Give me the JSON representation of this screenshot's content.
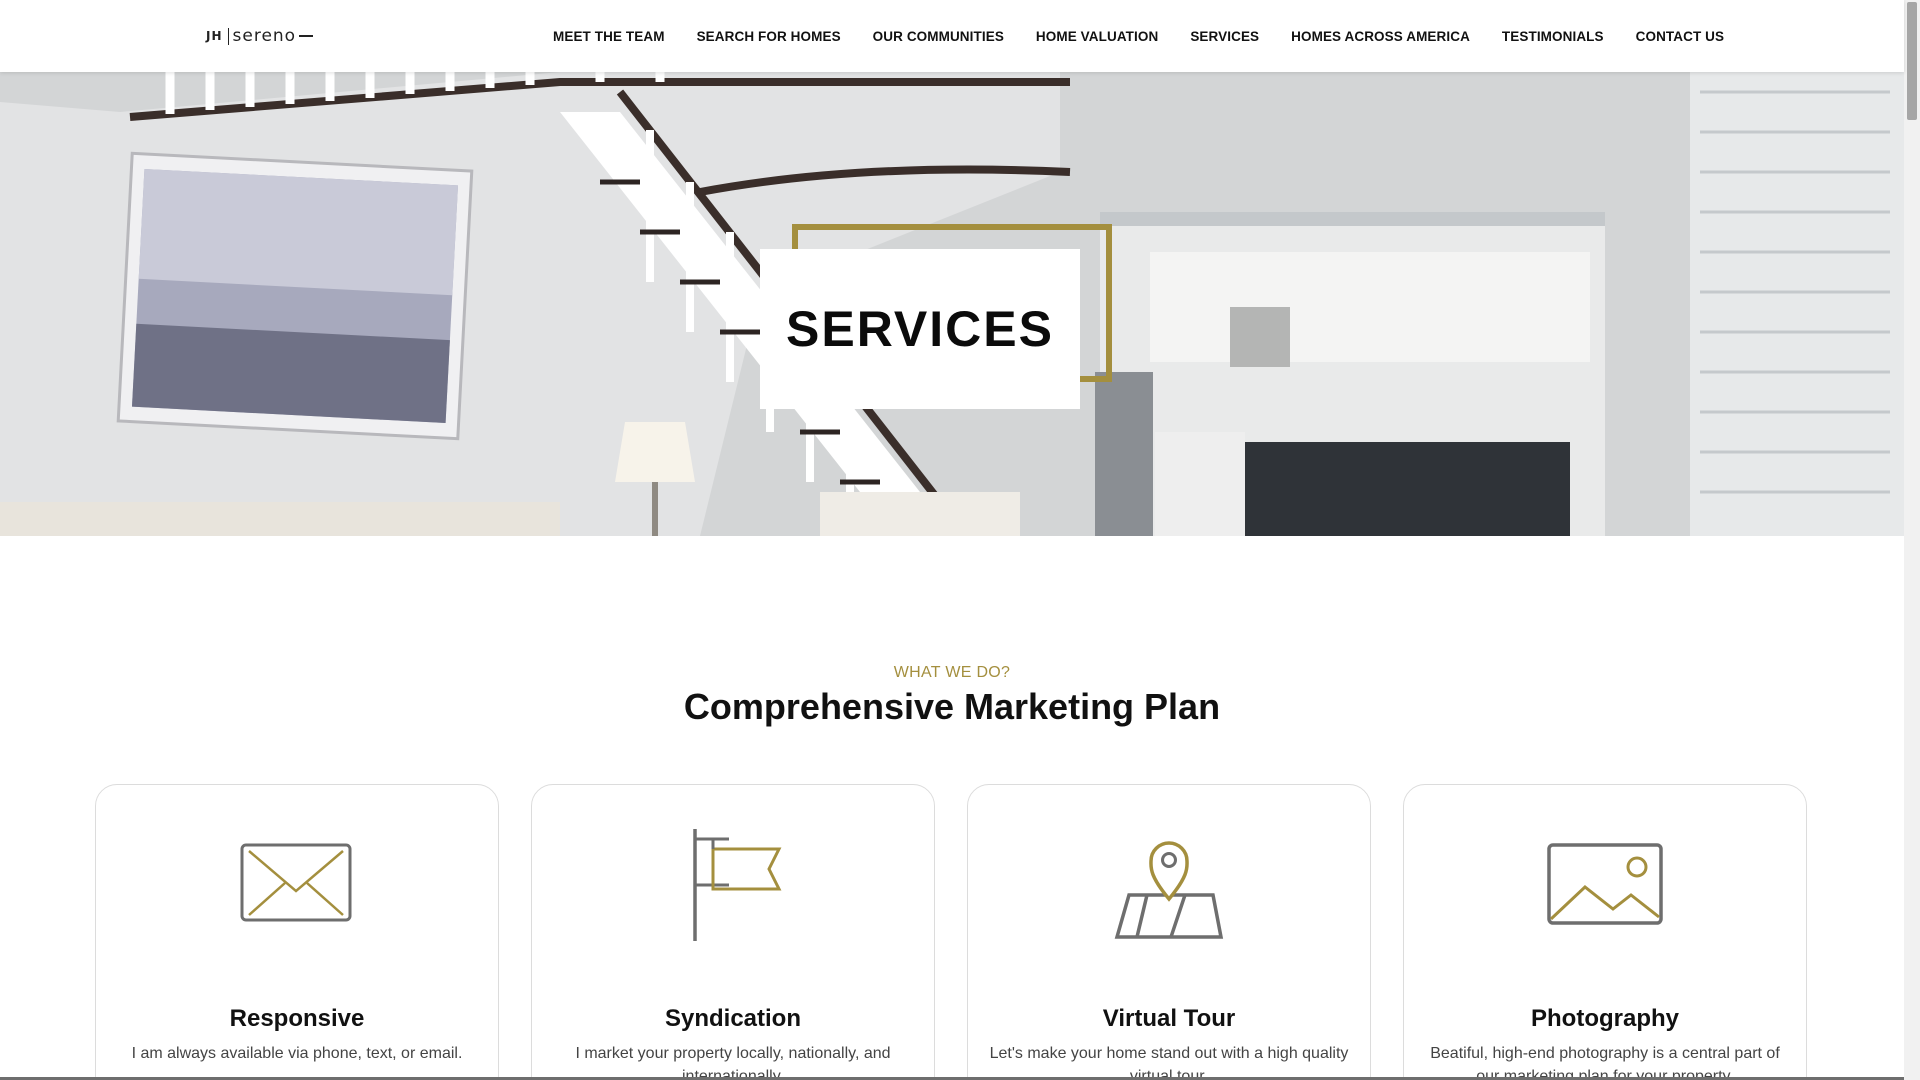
{
  "header": {
    "logo": {
      "mark": "JH",
      "text": "sereno"
    },
    "nav": [
      "MEET THE TEAM",
      "SEARCH FOR HOMES",
      "OUR COMMUNITIES",
      "HOME VALUATION",
      "SERVICES",
      "HOMES ACROSS AMERICA",
      "TESTIMONIALS",
      "CONTACT US"
    ]
  },
  "hero": {
    "title": "SERVICES"
  },
  "section": {
    "eyebrow": "WHAT WE DO?",
    "title": "Comprehensive Marketing Plan"
  },
  "cards": [
    {
      "icon": "envelope-icon",
      "title": "Responsive",
      "text": "I am always available via phone, text, or email."
    },
    {
      "icon": "flag-icon",
      "title": "Syndication",
      "text": "I market your property locally, nationally, and internationally."
    },
    {
      "icon": "map-pin-icon",
      "title": "Virtual Tour",
      "text": "Let's make your home stand out with a high quality virtual tour."
    },
    {
      "icon": "image-icon",
      "title": "Photography",
      "text": "Beatiful, high-end photography is a central part of our marketing plan for your property."
    }
  ],
  "colors": {
    "accent": "#a48f3e",
    "icon_gray": "#6e6e6e",
    "text": "#111111"
  }
}
